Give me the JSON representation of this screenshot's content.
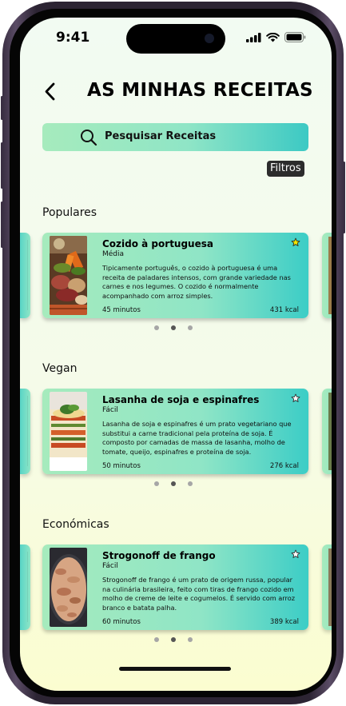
{
  "status_bar": {
    "time": "9:41"
  },
  "header": {
    "title": "AS MINHAS RECEITAS",
    "back_icon": "chevron-left-icon"
  },
  "search": {
    "placeholder": "Pesquisar Receitas",
    "icon": "search-icon"
  },
  "filters": {
    "label": "Filtros"
  },
  "sections": [
    {
      "title": "Populares",
      "card": {
        "title": "Cozido à portuguesa",
        "difficulty": "Média",
        "description": "Tipicamente português, o cozido à portuguesa é uma receita de paladares intensos, com grande variedade nas carnes e nos legumes. O cozido é normalmente acompanhado com arroz simples.",
        "time": "45 minutos",
        "kcal": "431 kcal",
        "favorite": true
      },
      "active_dot": 1
    },
    {
      "title": "Vegan",
      "card": {
        "title": "Lasanha de soja e espinafres",
        "difficulty": "Fácil",
        "description": "Lasanha de soja e espinafres é um prato vegetariano que substitui a carne tradicional pela proteína de soja. É composto por camadas de massa de lasanha, molho de tomate, queijo, espinafres e proteína de soja.",
        "time": "50 minutos",
        "kcal": "276 kcal",
        "favorite": false
      },
      "active_dot": 1
    },
    {
      "title": "Económicas",
      "card": {
        "title": "Strogonoff de frango",
        "difficulty": "Fácil",
        "description": "Strogonoff de frango é um prato de origem russa, popular na culinária brasileira, feito com tiras de frango cozido em molho de creme de leite e cogumelos. É servido com arroz branco e batata palha.",
        "time": "60 minutos",
        "kcal": "389 kcal",
        "favorite": false
      },
      "active_dot": 1
    }
  ],
  "colors": {
    "card_start": "#a6ebbd",
    "card_end": "#3ccdc6",
    "star_active": "#f2e600"
  }
}
